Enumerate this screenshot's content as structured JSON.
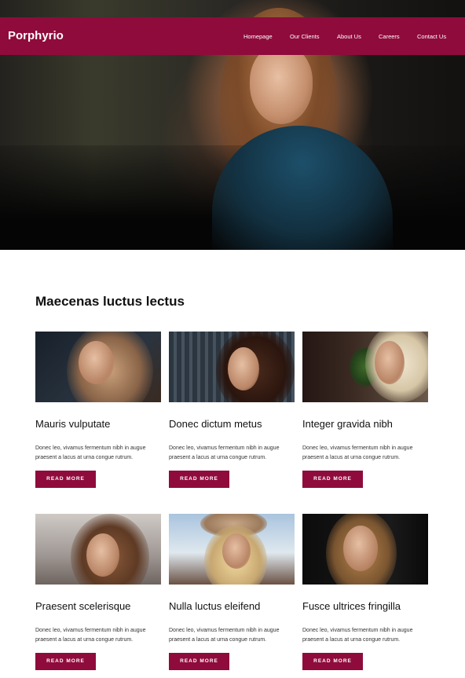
{
  "header": {
    "logo": "Porphyrio",
    "nav": [
      "Homepage",
      "Our Clients",
      "About Us",
      "Careers",
      "Contact Us"
    ]
  },
  "hero": {
    "image": "woman-portrait-hero"
  },
  "main": {
    "title": "Maecenas luctus lectus",
    "cards": [
      {
        "title": "Mauris vulputate",
        "text": "Donec leo, vivamus fermentum nibh in augue praesent a lacus at urna congue rutrum.",
        "button": "READ MORE"
      },
      {
        "title": "Donec dictum metus",
        "text": "Donec leo, vivamus fermentum nibh in augue praesent a lacus at urna congue rutrum.",
        "button": "READ MORE"
      },
      {
        "title": "Integer gravida nibh",
        "text": "Donec leo, vivamus fermentum nibh in augue praesent a lacus at urna congue rutrum.",
        "button": "READ MORE"
      },
      {
        "title": "Praesent scelerisque",
        "text": "Donec leo, vivamus fermentum nibh in augue praesent a lacus at urna congue rutrum.",
        "button": "READ MORE"
      },
      {
        "title": "Nulla luctus eleifend",
        "text": "Donec leo, vivamus fermentum nibh in augue praesent a lacus at urna congue rutrum.",
        "button": "READ MORE"
      },
      {
        "title": "Fusce ultrices fringilla",
        "text": "Donec leo, vivamus fermentum nibh in augue praesent a lacus at urna congue rutrum.",
        "button": "READ MORE"
      }
    ]
  },
  "colors": {
    "brand": "#8f0b3b"
  }
}
